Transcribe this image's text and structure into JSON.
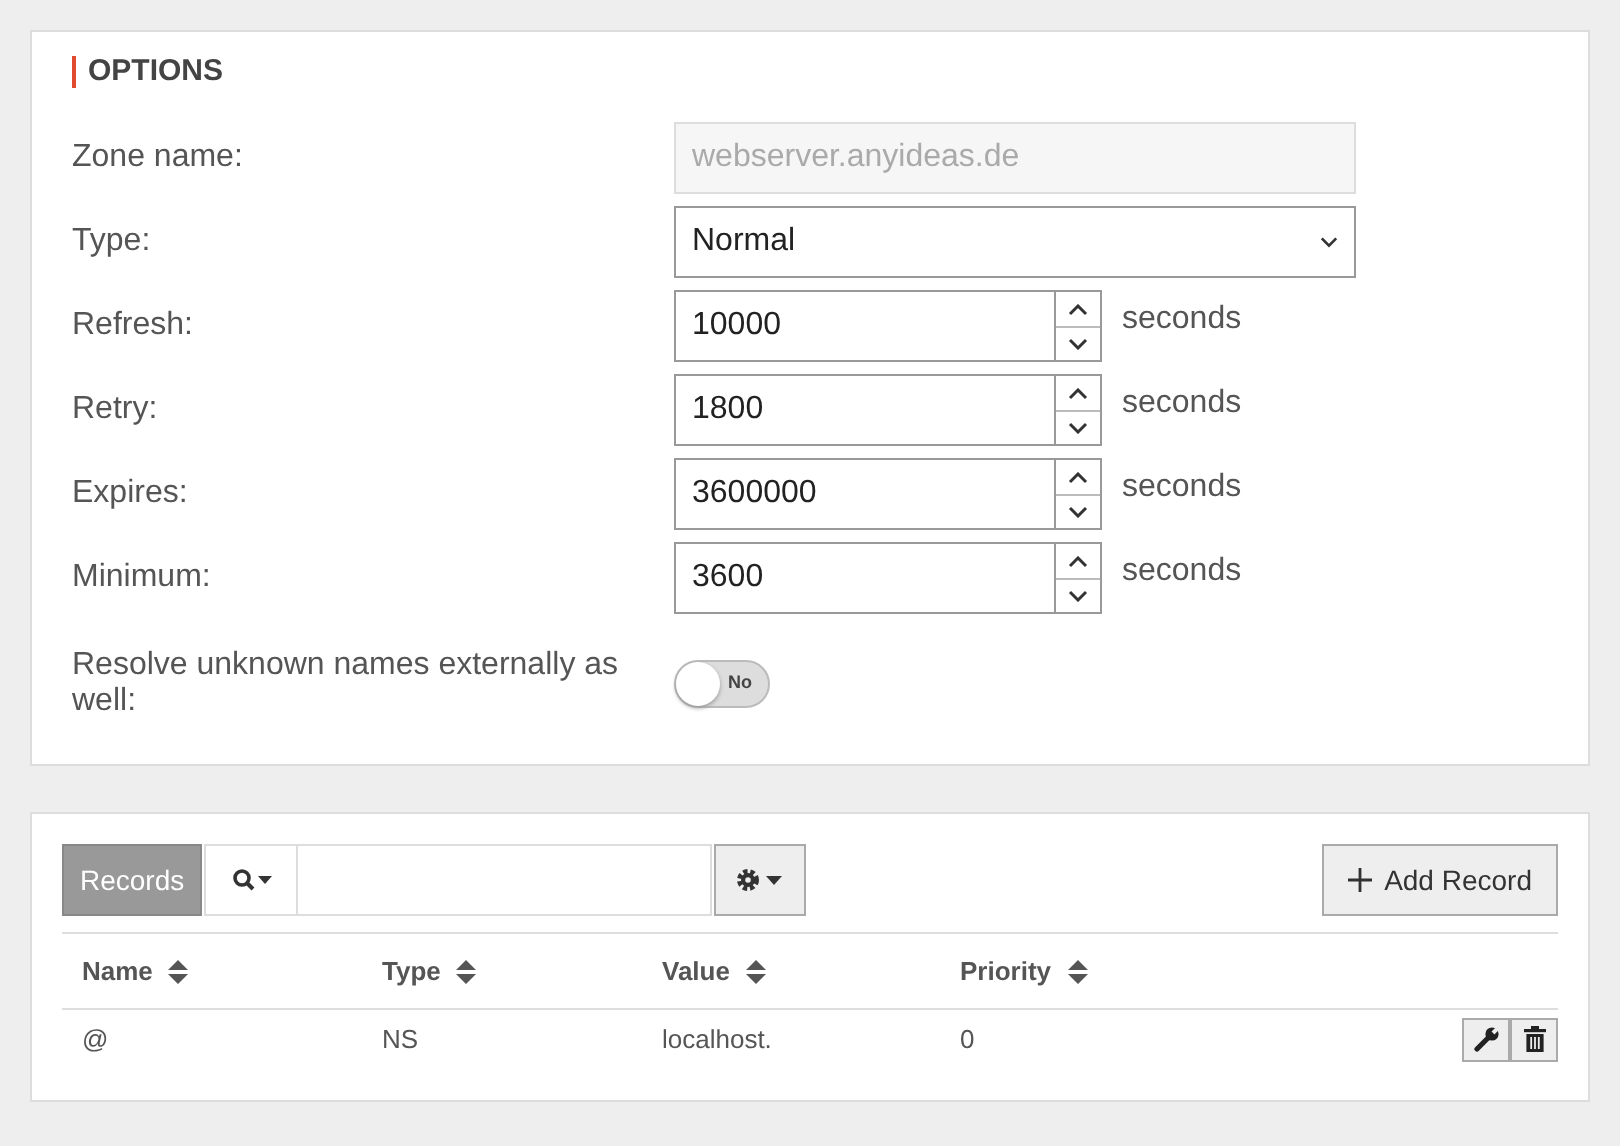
{
  "options": {
    "title": "OPTIONS",
    "zone_name": {
      "label": "Zone name:",
      "value": "webserver.anyideas.de",
      "disabled": true
    },
    "type": {
      "label": "Type:",
      "value": "Normal"
    },
    "timers": [
      {
        "label": "Refresh:",
        "value": "10000",
        "unit": "seconds"
      },
      {
        "label": "Retry:",
        "value": "1800",
        "unit": "seconds"
      },
      {
        "label": "Expires:",
        "value": "3600000",
        "unit": "seconds"
      },
      {
        "label": "Minimum:",
        "value": "3600",
        "unit": "seconds"
      }
    ],
    "resolve_externally": {
      "label": "Resolve unknown names externally as well:",
      "on": false,
      "text": "No"
    }
  },
  "records": {
    "title": "Records",
    "add_button": "Add Record",
    "columns": [
      "Name",
      "Type",
      "Value",
      "Priority"
    ],
    "rows": [
      [
        "@",
        "NS",
        "localhost.",
        "0"
      ]
    ]
  }
}
